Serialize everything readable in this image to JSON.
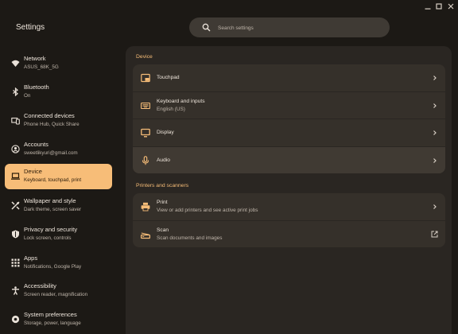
{
  "app": {
    "title": "Settings"
  },
  "window_controls": {
    "minimize_icon": "minimize-icon",
    "maximize_icon": "maximize-icon",
    "close_icon": "close-icon"
  },
  "search": {
    "placeholder": "Search settings",
    "value": "",
    "icon": "search-icon"
  },
  "colors": {
    "accent": "#f7bd78",
    "background": "#1c1915",
    "panel": "#2a2622",
    "card": "#35302a"
  },
  "sidebar": {
    "items": [
      {
        "label": "Network",
        "sub": "ASUS_68K_5G",
        "icon": "wifi-icon",
        "active": false
      },
      {
        "label": "Bluetooth",
        "sub": "On",
        "icon": "bluetooth-icon",
        "active": false
      },
      {
        "label": "Connected devices",
        "sub": "Phone Hub, Quick Share",
        "icon": "connected-devices-icon",
        "active": false
      },
      {
        "label": "Accounts",
        "sub": "sweetlikyuri@gmail.com",
        "icon": "account-icon",
        "active": false
      },
      {
        "label": "Device",
        "sub": "Keyboard, touchpad, print",
        "icon": "laptop-icon",
        "active": true
      },
      {
        "label": "Wallpaper and style",
        "sub": "Dark theme, screen saver",
        "icon": "palette-icon",
        "active": false
      },
      {
        "label": "Privacy and security",
        "sub": "Lock screen, controls",
        "icon": "shield-icon",
        "active": false
      },
      {
        "label": "Apps",
        "sub": "Notifications, Google Play",
        "icon": "apps-grid-icon",
        "active": false
      },
      {
        "label": "Accessibility",
        "sub": "Screen reader, magnification",
        "icon": "accessibility-icon",
        "active": false
      },
      {
        "label": "System preferences",
        "sub": "Storage, power, language",
        "icon": "system-preferences-icon",
        "active": false
      }
    ]
  },
  "main": {
    "device_section": {
      "title": "Device",
      "rows": [
        {
          "label": "Touchpad",
          "sub": "",
          "icon": "touchpad-icon",
          "action": "chevron-right-icon"
        },
        {
          "label": "Keyboard and inputs",
          "sub": "English (US)",
          "icon": "keyboard-icon",
          "action": "chevron-right-icon"
        },
        {
          "label": "Display",
          "sub": "",
          "icon": "display-icon",
          "action": "chevron-right-icon"
        },
        {
          "label": "Audio",
          "sub": "",
          "icon": "microphone-icon",
          "action": "chevron-right-icon",
          "highlighted": true
        }
      ]
    },
    "printers_section": {
      "title": "Printers and scanners",
      "rows": [
        {
          "label": "Print",
          "sub": "View or add printers and see active print jobs",
          "icon": "printer-icon",
          "action": "chevron-right-icon"
        },
        {
          "label": "Scan",
          "sub": "Scan documents and images",
          "icon": "scanner-icon",
          "action": "external-link-icon"
        }
      ]
    }
  }
}
